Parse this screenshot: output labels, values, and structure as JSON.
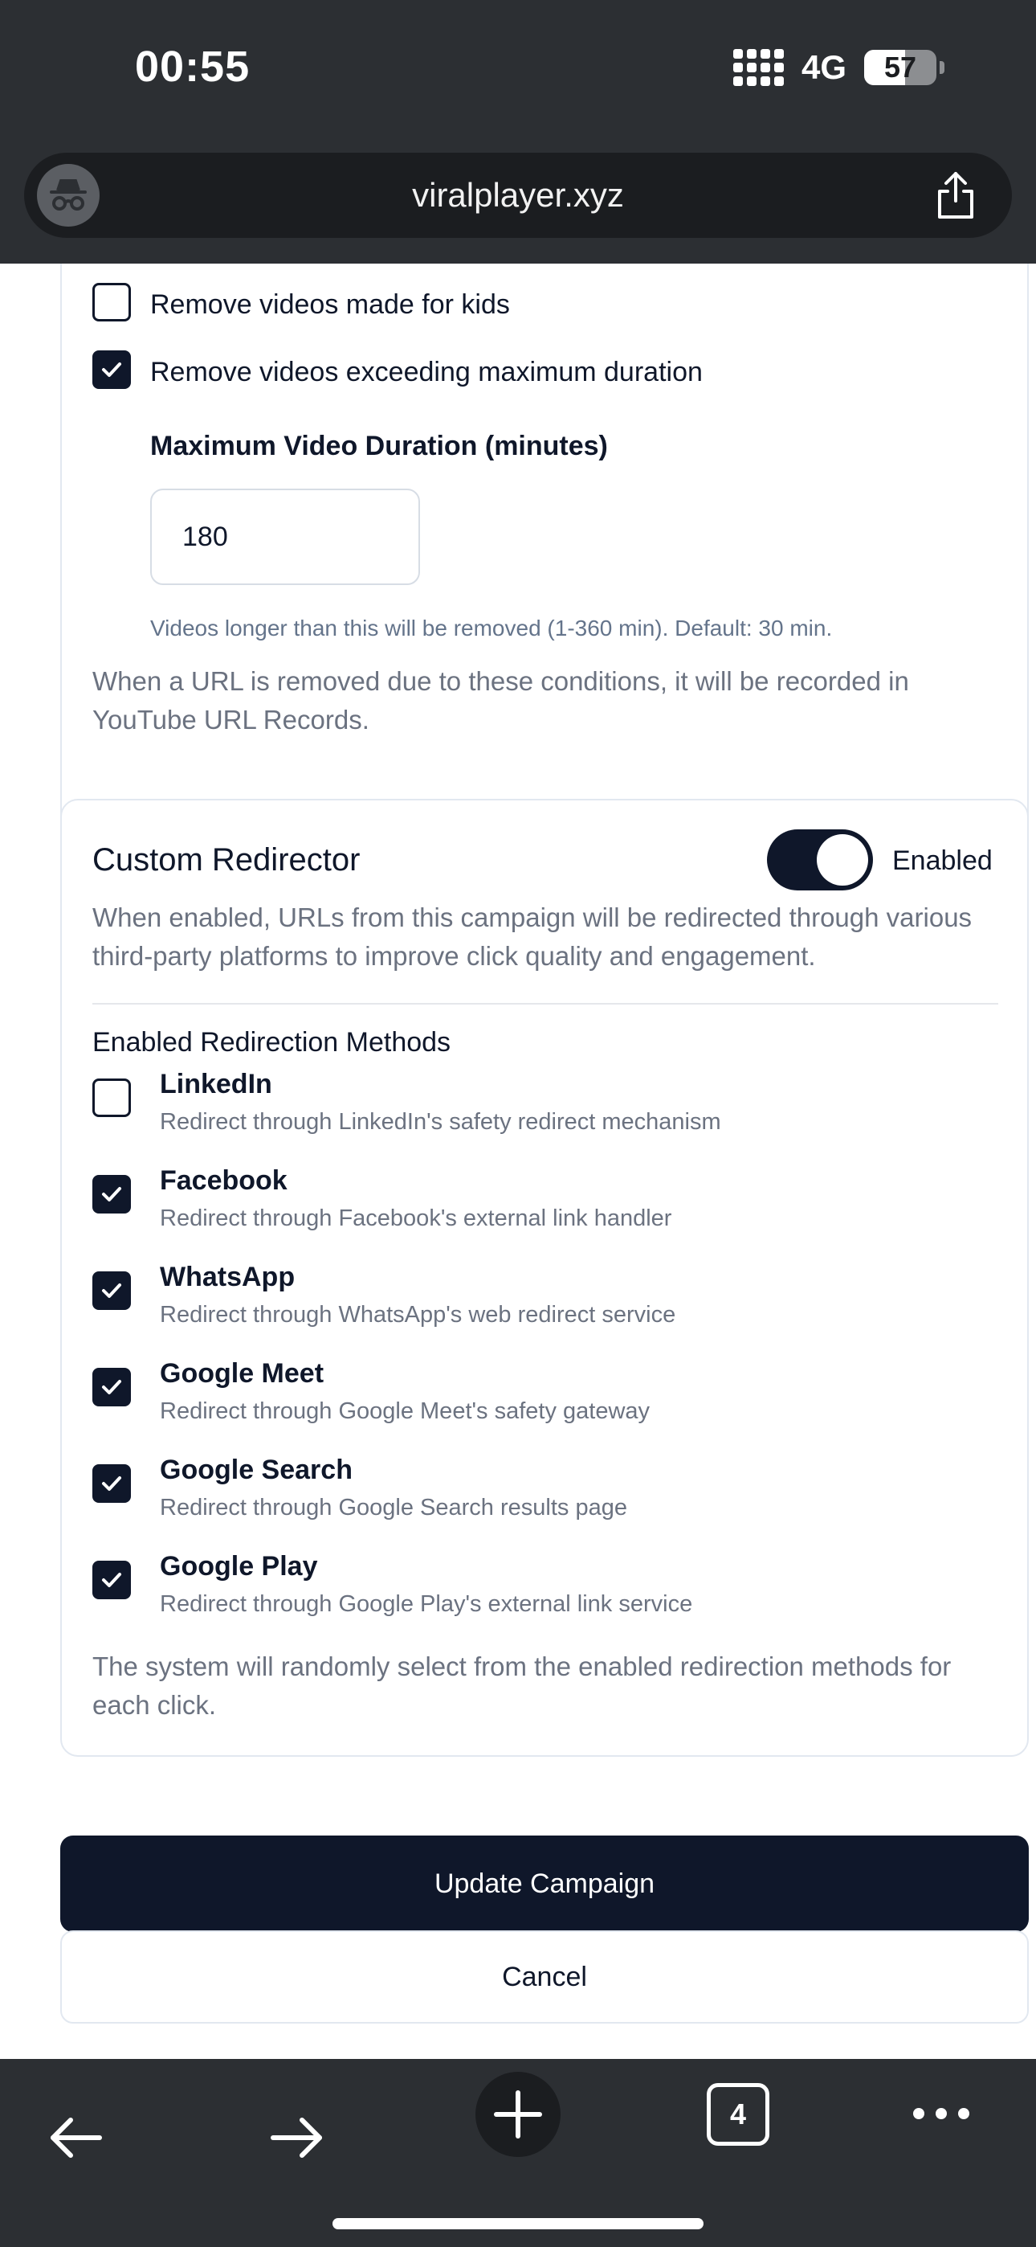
{
  "status_bar": {
    "time": "00:55",
    "network": "4G",
    "battery": "57",
    "battery_level_percent": 57
  },
  "browser": {
    "url": "viralplayer.xyz",
    "tab_count": "4"
  },
  "filter_section": {
    "remove_kids_label": "Remove videos made for kids",
    "remove_kids_checked": false,
    "remove_long_label": "Remove videos exceeding maximum duration",
    "remove_long_checked": true,
    "max_duration_label": "Maximum Video Duration (minutes)",
    "max_duration_value": "180",
    "max_duration_hint": "Videos longer than this will be removed (1-360 min). Default: 30 min.",
    "note": "When a URL is removed due to these conditions, it will be recorded in YouTube URL Records."
  },
  "redirector": {
    "title": "Custom Redirector",
    "toggle_label": "Enabled",
    "toggle_on": true,
    "description": "When enabled, URLs from this campaign will be redirected through various third-party platforms to improve click quality and engagement.",
    "methods_title": "Enabled Redirection Methods",
    "methods": [
      {
        "name": "LinkedIn",
        "desc": "Redirect through LinkedIn's safety redirect mechanism",
        "checked": false
      },
      {
        "name": "Facebook",
        "desc": "Redirect through Facebook's external link handler",
        "checked": true
      },
      {
        "name": "WhatsApp",
        "desc": "Redirect through WhatsApp's web redirect service",
        "checked": true
      },
      {
        "name": "Google Meet",
        "desc": "Redirect through Google Meet's safety gateway",
        "checked": true
      },
      {
        "name": "Google Search",
        "desc": "Redirect through Google Search results page",
        "checked": true
      },
      {
        "name": "Google Play",
        "desc": "Redirect through Google Play's external link service",
        "checked": true
      }
    ],
    "footer_note": "The system will randomly select from the enabled redirection methods for each click."
  },
  "actions": {
    "update_label": "Update Campaign",
    "cancel_label": "Cancel"
  },
  "icons": {
    "incognito": "incognito-icon",
    "share": "share-icon",
    "back": "arrow-left-icon",
    "forward": "arrow-right-icon",
    "new_tab": "plus-icon",
    "tabs": "tabs-icon",
    "more": "more-icon"
  },
  "colors": {
    "primary": "#0f172a",
    "chrome": "#2c2f33",
    "muted_text": "#6b7280"
  }
}
